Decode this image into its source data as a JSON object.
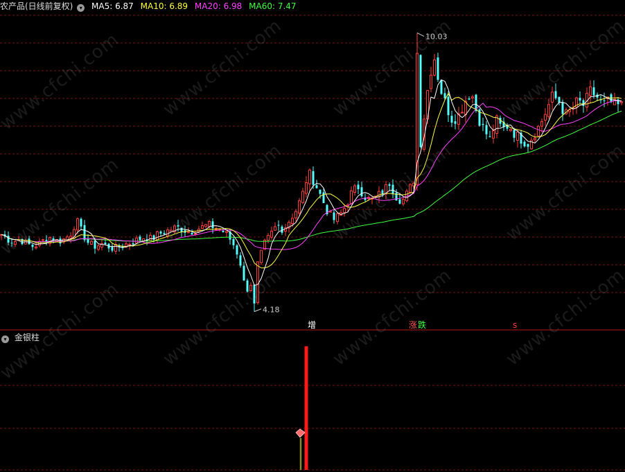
{
  "header": {
    "title": "农产品(日线前复权)",
    "ma5": "MA5: 6.87",
    "ma10": "MA10: 6.89",
    "ma20": "MA20: 6.98",
    "ma60": "MA60: 7.47"
  },
  "sub_panel": {
    "title": "金银柱"
  },
  "annotations": {
    "high": "10.03",
    "low": "4.18",
    "signal_zeng": "增",
    "signal_zhang": "涨",
    "signal_die": "跌",
    "signal_s": "s"
  },
  "watermark": "www.cfchi.com",
  "colors": {
    "background": "#000000",
    "grid": "#7a1010",
    "up": "#ff3b3b",
    "down": "#54ffff",
    "ma5": "#ffffff",
    "ma10": "#ffff40",
    "ma20": "#ff40ff",
    "ma60": "#40ff40",
    "bar_red": "#ff1a1a",
    "bar_olive": "#8a8a2a"
  },
  "chart_data": {
    "type": "candlestick",
    "series_names": [
      "MA5",
      "MA10",
      "MA20",
      "MA60"
    ],
    "price_high": 10.03,
    "price_low": 4.18,
    "ma_latest": {
      "MA5": 6.87,
      "MA10": 6.89,
      "MA20": 6.98,
      "MA60": 7.47
    },
    "close_path": [
      5.8,
      5.7,
      5.65,
      5.7,
      5.6,
      5.55,
      5.6,
      5.7,
      5.75,
      5.65,
      5.7,
      5.8,
      6.1,
      5.8,
      5.6,
      5.55,
      5.6,
      5.55,
      5.5,
      5.55,
      5.6,
      5.65,
      5.7,
      5.75,
      5.7,
      5.8,
      5.85,
      5.9,
      5.95,
      5.9,
      5.85,
      5.9,
      5.95,
      6.0,
      5.95,
      5.9,
      5.8,
      5.6,
      5.3,
      4.6,
      4.8,
      5.2,
      5.6,
      5.8,
      6.0,
      5.9,
      6.1,
      6.3,
      6.6,
      7.1,
      6.9,
      6.6,
      6.3,
      6.1,
      6.2,
      6.4,
      6.7,
      6.8,
      6.6,
      6.5,
      6.6,
      6.7,
      6.9,
      6.6,
      6.5,
      6.7,
      7.0,
      7.8,
      8.8,
      9.6,
      8.9,
      8.5,
      8.2,
      8.3,
      8.6,
      8.8,
      8.3,
      8.0,
      7.8,
      8.2,
      8.0,
      8.1,
      7.9,
      7.8,
      7.7,
      7.9,
      8.1,
      8.4,
      8.7,
      8.6,
      8.3,
      8.4,
      8.6,
      8.5,
      8.8,
      8.7,
      8.5,
      8.6,
      8.5,
      8.5
    ],
    "sub_bars": [
      {
        "color": "bar_olive",
        "from": 0.0,
        "to": 0.25
      },
      {
        "color": "bar_red",
        "from": 0.0,
        "to": 0.97
      }
    ]
  }
}
